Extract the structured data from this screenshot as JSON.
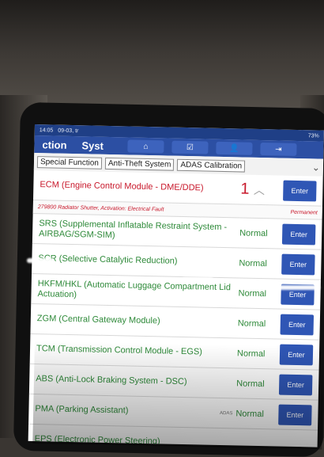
{
  "status_bar": {
    "time": "14:05",
    "date": "09-03, tr",
    "right": "73%"
  },
  "nav": {
    "title_left": "ction",
    "title_right": "Syst",
    "buttons": [
      "home-icon",
      "checklist-icon",
      "person-icon",
      "exit-icon"
    ]
  },
  "tabs": [
    "Special Function",
    "Anti-Theft System",
    "ADAS Calibration"
  ],
  "rows": [
    {
      "name": "ECM (Engine Control Module - DME/DDE)",
      "status": "1",
      "enter": "Enter",
      "fault": true
    },
    {
      "name": "SRS (Supplemental Inflatable Restraint System - AIRBAG/SGM-SIM)",
      "status": "Normal",
      "enter": "Enter"
    },
    {
      "name": "SCR (Selective Catalytic Reduction)",
      "status": "Normal",
      "enter": "Enter"
    },
    {
      "name": "HKFM/HKL (Automatic Luggage Compartment Lid Actuation)",
      "status": "Normal",
      "enter": "Enter"
    },
    {
      "name": "ZGM (Central Gateway Module)",
      "status": "Normal",
      "enter": "Enter"
    },
    {
      "name": "TCM (Transmission Control Module - EGS)",
      "status": "Normal",
      "enter": "Enter"
    },
    {
      "name": "ABS (Anti-Lock Braking System - DSC)",
      "status": "Normal",
      "enter": "Enter"
    },
    {
      "name": "PMA (Parking Assistant)",
      "status": "Normal",
      "enter": "Enter",
      "badge": "ADAS"
    },
    {
      "name": "EPS (Electronic Power Steering)",
      "status": "",
      "enter": ""
    }
  ],
  "fault_detail": {
    "code": "279800 Radiator Shutter, Activation: Electrical Fault",
    "type": "Permanent"
  }
}
